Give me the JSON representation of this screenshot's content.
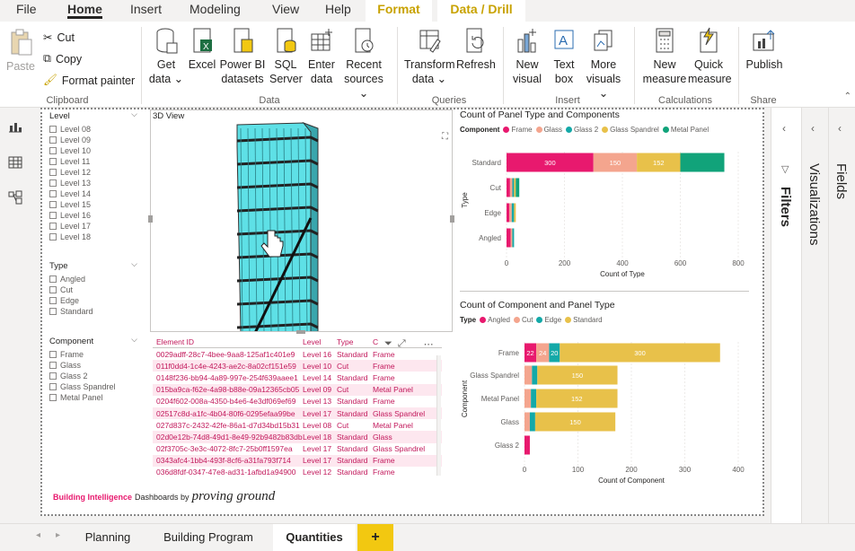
{
  "menu": {
    "file": "File",
    "home": "Home",
    "insert": "Insert",
    "modeling": "Modeling",
    "view": "View",
    "help": "Help",
    "format": "Format",
    "data_drill": "Data / Drill"
  },
  "ribbon": {
    "paste": "Paste",
    "cut": "Cut",
    "copy": "Copy",
    "format_painter": "Format painter",
    "get_data": "Get",
    "get_data2": "data ⌄",
    "excel": "Excel",
    "pbi1": "Power BI",
    "pbi2": "datasets",
    "sql1": "SQL",
    "sql2": "Server",
    "enter1": "Enter",
    "enter2": "data",
    "recent1": "Recent",
    "recent2": "sources ⌄",
    "transform1": "Transform",
    "transform2": "data ⌄",
    "refresh": "Refresh",
    "newvis1": "New",
    "newvis2": "visual",
    "textbox1": "Text",
    "textbox2": "box",
    "more1": "More",
    "more2": "visuals ⌄",
    "newmeas1": "New",
    "newmeas2": "measure",
    "quick1": "Quick",
    "quick2": "measure",
    "publish": "Publish",
    "groups": {
      "clipboard": "Clipboard",
      "data": "Data",
      "queries": "Queries",
      "insert": "Insert",
      "calculations": "Calculations",
      "share": "Share"
    }
  },
  "slicers": {
    "level": {
      "title": "Level",
      "items": [
        "Level 08",
        "Level 09",
        "Level 10",
        "Level 11",
        "Level 12",
        "Level 13",
        "Level 14",
        "Level 15",
        "Level 16",
        "Level 17",
        "Level 18"
      ]
    },
    "type": {
      "title": "Type",
      "items": [
        "Angled",
        "Cut",
        "Edge",
        "Standard"
      ]
    },
    "component": {
      "title": "Component",
      "items": [
        "Frame",
        "Glass",
        "Glass 2",
        "Glass Spandrel",
        "Metal Panel"
      ]
    }
  },
  "view3d": {
    "title": "3D View"
  },
  "table": {
    "headers": [
      "Element ID",
      "Level",
      "Type",
      "C"
    ],
    "rows": [
      [
        "0029adff-28c7-4bee-9aa8-125af1c401e9",
        "Level 16",
        "Standard",
        "Frame"
      ],
      [
        "011f0dd4-1c4e-4243-ae2c-8a02cf151e59",
        "Level 10",
        "Cut",
        "Frame"
      ],
      [
        "0148f236-bb94-4a89-997e-254f639aaee1",
        "Level 14",
        "Standard",
        "Frame"
      ],
      [
        "015ba9ca-f62e-4a98-b88e-09a12365cb05",
        "Level 09",
        "Cut",
        "Metal Panel"
      ],
      [
        "0204f602-008a-4350-b4e6-4e3df069ef69",
        "Level 13",
        "Standard",
        "Frame"
      ],
      [
        "02517c8d-a1fc-4b04-80f6-0295efaa99be",
        "Level 17",
        "Standard",
        "Glass Spandrel"
      ],
      [
        "027d837c-2432-42fe-86a1-d7d34bd15b31",
        "Level 08",
        "Cut",
        "Metal Panel"
      ],
      [
        "02d0e12b-74d8-49d1-8e49-92b9482b83db",
        "Level 18",
        "Standard",
        "Glass"
      ],
      [
        "02f3705c-3e3c-4072-8fc7-25b0ff1597ea",
        "Level 17",
        "Standard",
        "Glass Spandrel"
      ],
      [
        "0343afc4-1bb4-493f-8cf6-a31fa793f714",
        "Level 17",
        "Standard",
        "Frame"
      ],
      [
        "036d8fdf-0347-47e8-ad31-1afbd1a94900",
        "Level 12",
        "Standard",
        "Frame"
      ]
    ]
  },
  "chart_data": [
    {
      "type": "bar",
      "orientation": "horizontal-stacked",
      "title": "Count of Panel Type and Components",
      "legend_title": "Component",
      "categories": [
        "Standard",
        "Cut",
        "Edge",
        "Angled"
      ],
      "xlabel": "Count of Type",
      "ylabel": "Type",
      "xticks": [
        "0",
        "200",
        "400",
        "600",
        "800"
      ],
      "xlim": [
        0,
        800
      ],
      "series": [
        {
          "name": "Frame",
          "color": "#e8196e",
          "values": [
            300,
            12,
            10,
            14
          ]
        },
        {
          "name": "Glass",
          "color": "#f4a58e",
          "values": [
            150,
            8,
            8,
            6
          ]
        },
        {
          "name": "Glass 2",
          "color": "#14a9a8",
          "values": [
            0,
            6,
            8,
            6
          ]
        },
        {
          "name": "Glass Spandrel",
          "color": "#e8c14a",
          "values": [
            150,
            6,
            6,
            0
          ]
        },
        {
          "name": "Metal Panel",
          "color": "#11a37a",
          "values": [
            152,
            12,
            0,
            0
          ]
        }
      ],
      "data_labels": [
        [
          "300",
          "150",
          "150",
          "152"
        ],
        [],
        [],
        []
      ]
    },
    {
      "type": "bar",
      "orientation": "horizontal-stacked",
      "title": "Count of Component and Panel Type",
      "legend_title": "Type",
      "categories": [
        "Frame",
        "Glass Spandrel",
        "Metal Panel",
        "Glass",
        "Glass 2"
      ],
      "xlabel": "Count of Component",
      "ylabel": "Component",
      "xticks": [
        "0",
        "100",
        "200",
        "300",
        "400"
      ],
      "xlim": [
        0,
        400
      ],
      "series": [
        {
          "name": "Angled",
          "color": "#e8196e",
          "values": [
            22,
            0,
            0,
            0,
            10
          ]
        },
        {
          "name": "Cut",
          "color": "#f4a58e",
          "values": [
            24,
            14,
            12,
            10,
            0
          ]
        },
        {
          "name": "Edge",
          "color": "#14a9a8",
          "values": [
            20,
            10,
            10,
            10,
            0
          ]
        },
        {
          "name": "Standard",
          "color": "#e8c14a",
          "values": [
            300,
            150,
            152,
            150,
            0
          ]
        }
      ],
      "data_labels": [
        [
          "22",
          "24",
          "20",
          "300"
        ],
        [
          "",
          "",
          "",
          "150"
        ],
        [
          "",
          "",
          "",
          "152"
        ],
        [
          "",
          "",
          "",
          "150"
        ],
        []
      ]
    }
  ],
  "panes": {
    "filters": "Filters",
    "visualizations": "Visualizations",
    "fields": "Fields"
  },
  "footer": {
    "brand": "Building Intelligence",
    "dash": "Dashboards by",
    "pg": "proving ground"
  },
  "pages": {
    "p1": "Planning",
    "p2": "Building Program",
    "p3": "Quantities",
    "add": "+"
  }
}
